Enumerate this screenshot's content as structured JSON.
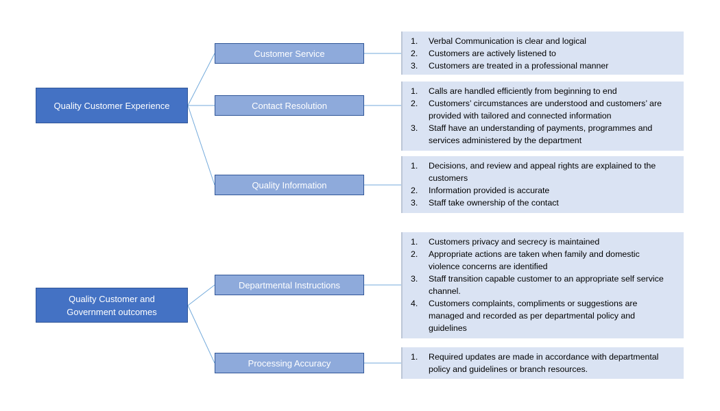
{
  "groups": [
    {
      "label": "Quality Customer Experience",
      "children": [
        {
          "label": "Customer Service",
          "items": [
            "Verbal Communication is clear and logical",
            "Customers are actively listened to",
            "Customers are treated in a professional manner"
          ]
        },
        {
          "label": "Contact Resolution",
          "items": [
            "Calls are handled efficiently from beginning to end",
            "Customers’ circumstances are understood and customers’ are provided with tailored and connected information",
            "Staff have an understanding of payments, programmes and services administered by the department"
          ]
        },
        {
          "label": "Quality Information",
          "items": [
            "Decisions, and review and appeal rights are explained to the customers",
            "Information provided is accurate",
            "Staff take ownership of the contact"
          ]
        }
      ]
    },
    {
      "label": "Quality Customer and Government outcomes",
      "children": [
        {
          "label": "Departmental Instructions",
          "items": [
            "Customers privacy and secrecy is maintained",
            "Appropriate actions are taken when family and domestic violence concerns are identified",
            "Staff transition capable customer to an appropriate self service channel.",
            "Customers complaints, compliments or suggestions are managed and recorded as per departmental policy and guidelines"
          ]
        },
        {
          "label": "Processing Accuracy",
          "items": [
            "Required updates are made in accordance with departmental policy and guidelines or branch resources."
          ]
        }
      ]
    }
  ],
  "colors": {
    "root": "#4472c4",
    "mid": "#8eaadb",
    "detail": "#dae3f3",
    "connector": "#5b9bd5"
  }
}
